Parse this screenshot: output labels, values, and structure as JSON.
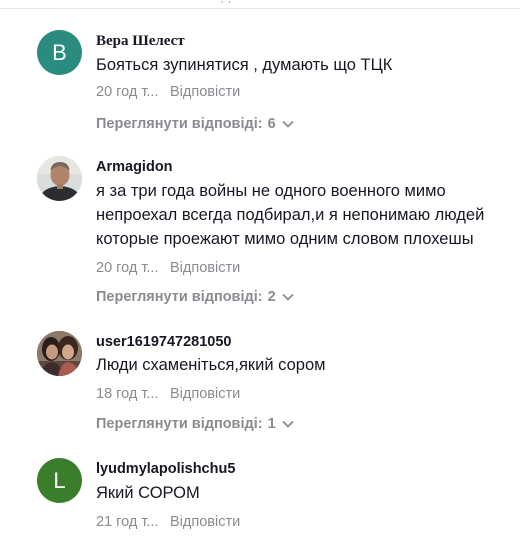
{
  "top_fragment": "· ·",
  "comments": [
    {
      "username": "Вера Шелест",
      "avatar_letter": "B",
      "avatar_color": "#2a8c7e",
      "text": [
        "Бояться зупинятися , думають що ТЦК"
      ],
      "time": "20 год т...",
      "reply_label": "Відповісти",
      "view_replies_label": "Переглянути відповіді:",
      "view_replies_count": "6"
    },
    {
      "username": "Armagidon",
      "avatar_icon": "person-photo-icon",
      "text": [
        "я за три года войны не одного военного мимо",
        "непроехал всегда подбирал,и я непонимаю людей",
        "которые проежают мимо одним словом плохешы"
      ],
      "time": "20 год т...",
      "reply_label": "Відповісти",
      "view_replies_label": "Переглянути відповіді:",
      "view_replies_count": "2"
    },
    {
      "username": "user1619747281050",
      "avatar_icon": "two-people-photo-icon",
      "text": [
        "Люди схаменіться,який сором"
      ],
      "time": "18 год т...",
      "reply_label": "Відповісти",
      "view_replies_label": "Переглянути відповіді:",
      "view_replies_count": "1"
    },
    {
      "username": "lyudmylapolishchu5",
      "avatar_letter": "L",
      "avatar_color": "#3a7d2a",
      "text": [
        "Який СОРОМ"
      ],
      "time": "21 год т...",
      "reply_label": "Відповісти"
    }
  ]
}
